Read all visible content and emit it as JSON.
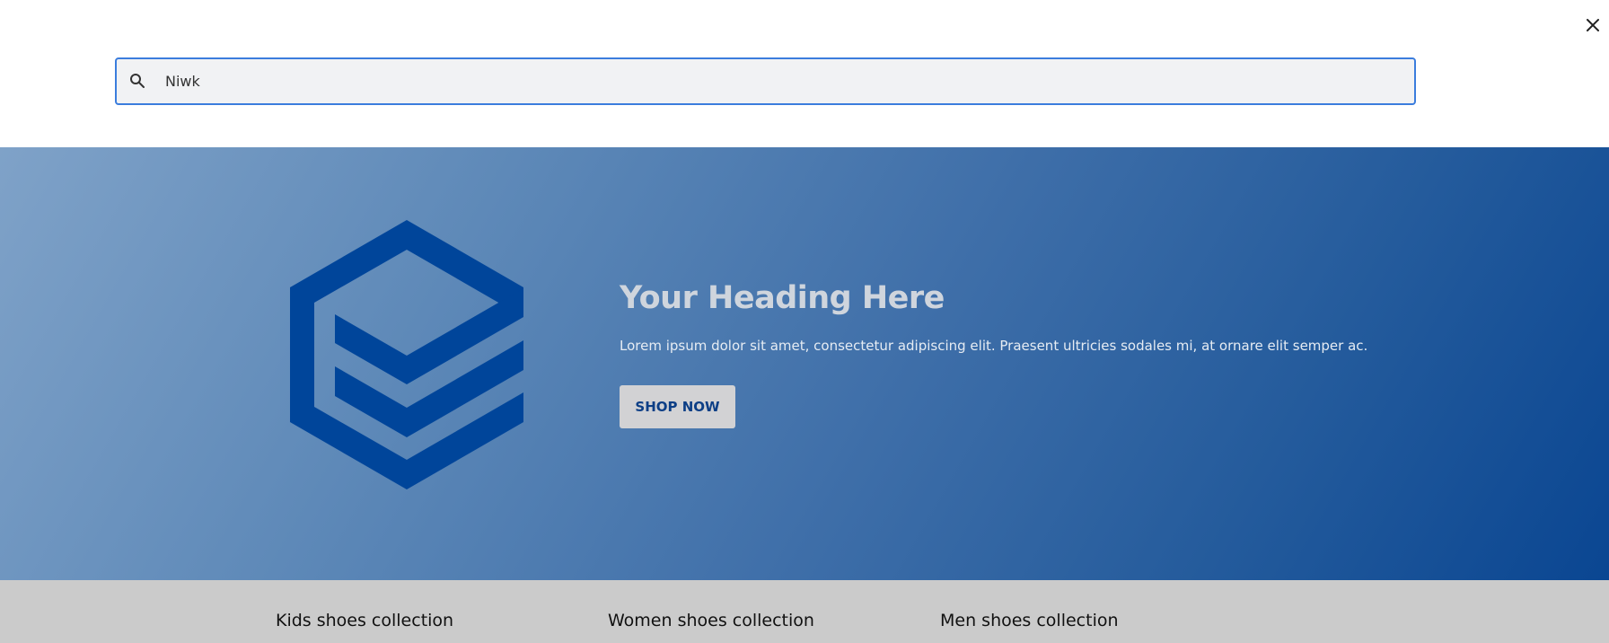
{
  "search": {
    "value": "Niwk",
    "icon": "search-icon"
  },
  "close": {
    "icon": "close-icon"
  },
  "hero": {
    "heading": "Your Heading Here",
    "body": "Lorem ipsum dolor sit amet, consectetur adipiscing elit. Praesent ultricies sodales mi, at ornare elit semper ac.",
    "button_label": "SHOP NOW",
    "logo_icon": "hexagon-stack-logo",
    "colors": {
      "logo": "#00459a",
      "heading": "#cfd5dd",
      "button_bg": "#d2d2d4",
      "button_text": "#0d3f86",
      "gradient_start": "#7fa2c8",
      "gradient_end": "#0a4692"
    }
  },
  "collections": [
    {
      "label": "Kids shoes collection"
    },
    {
      "label": "Women shoes collection"
    },
    {
      "label": "Men shoes collection"
    }
  ]
}
